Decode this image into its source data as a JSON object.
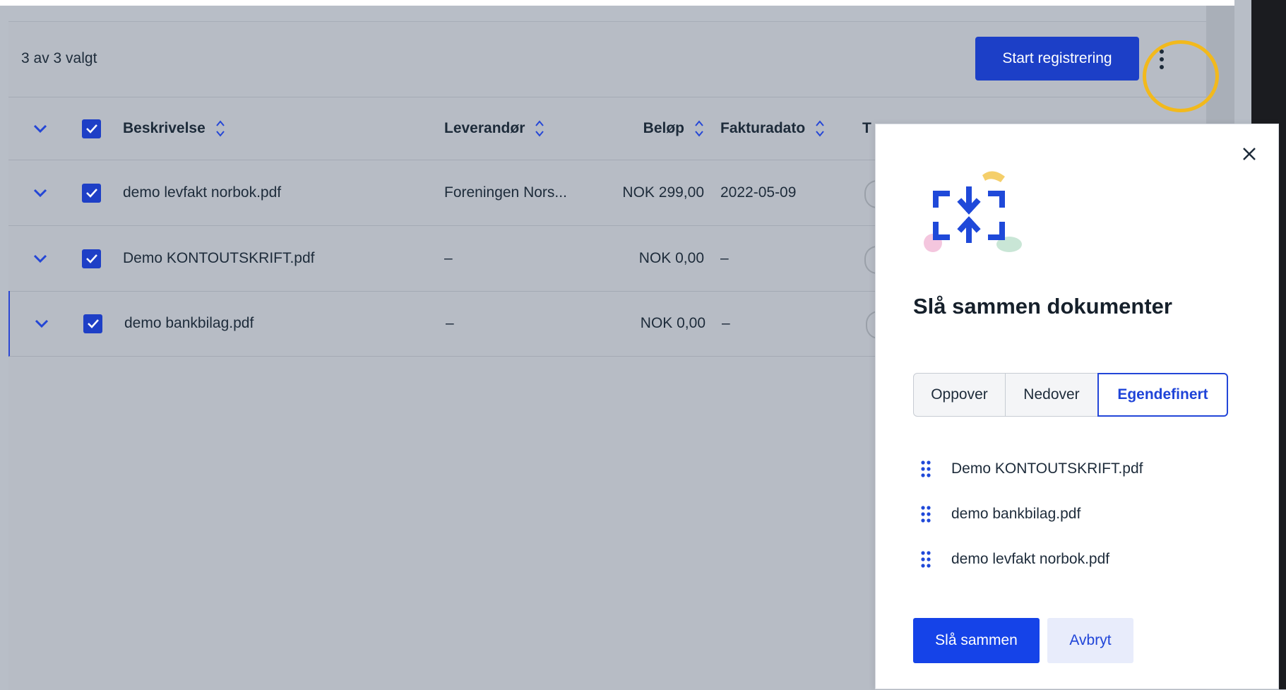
{
  "selection": {
    "count_text": "3 av 3 valgt"
  },
  "toolbar": {
    "start_label": "Start registrering",
    "more_icon": "more-vertical-icon"
  },
  "table": {
    "columns": [
      "Beskrivelse",
      "Leverandør",
      "Beløp",
      "Fakturadato",
      "T"
    ],
    "rows": [
      {
        "beskrivelse": "demo levfakt norbok.pdf",
        "leverandor": "Foreningen Nors...",
        "belop": "NOK 299,00",
        "fakturadato": "2022-05-09"
      },
      {
        "beskrivelse": "Demo KONTOUTSKRIFT.pdf",
        "leverandor": "–",
        "belop": "NOK 0,00",
        "fakturadato": "–"
      },
      {
        "beskrivelse": "demo bankbilag.pdf",
        "leverandor": "–",
        "belop": "NOK 0,00",
        "fakturadato": "–"
      }
    ]
  },
  "merge_dialog": {
    "title": "Slå sammen dokumenter",
    "order_options": [
      "Oppover",
      "Nedover",
      "Egendefinert"
    ],
    "selected_option": "Egendefinert",
    "documents": [
      "Demo KONTOUTSKRIFT.pdf",
      "demo bankbilag.pdf",
      "demo levfakt norbok.pdf"
    ],
    "confirm_label": "Slå sammen",
    "cancel_label": "Avbryt"
  },
  "colors": {
    "primary": "#1543e8",
    "highlight_ring": "#f2b91c",
    "overlay": "#b7bcc5"
  }
}
